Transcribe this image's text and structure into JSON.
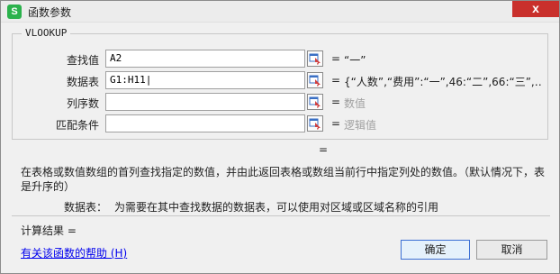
{
  "window": {
    "title": "函数参数",
    "app_icon_letter": "S",
    "close_label": "x"
  },
  "function_name": "VLOOKUP",
  "args": [
    {
      "label": "查找值",
      "value": "A2",
      "result": "“一”",
      "placeholder": false
    },
    {
      "label": "数据表",
      "value": "G1:H11|",
      "result": "{“人数”,“费用”:“一”,46:“二”,66:“三”,…",
      "placeholder": false
    },
    {
      "label": "列序数",
      "value": "",
      "result": "数值",
      "placeholder": true
    },
    {
      "label": "匹配条件",
      "value": "",
      "result": "逻辑值",
      "placeholder": true
    }
  ],
  "equals": "=",
  "formula_result_eq": "=",
  "description": "在表格或数值数组的首列查找指定的数值，并由此返回表格或数组当前行中指定列处的数值。（默认情况下，表是升序的）",
  "arg_description": {
    "name": "数据表：",
    "text": "为需要在其中查找数据的数据表，可以使用对区域或区域名称的引用"
  },
  "calc_result_label": "计算结果 =",
  "help_link": "有关该函数的帮助 (H)",
  "buttons": {
    "ok": "确定",
    "cancel": "取消"
  }
}
